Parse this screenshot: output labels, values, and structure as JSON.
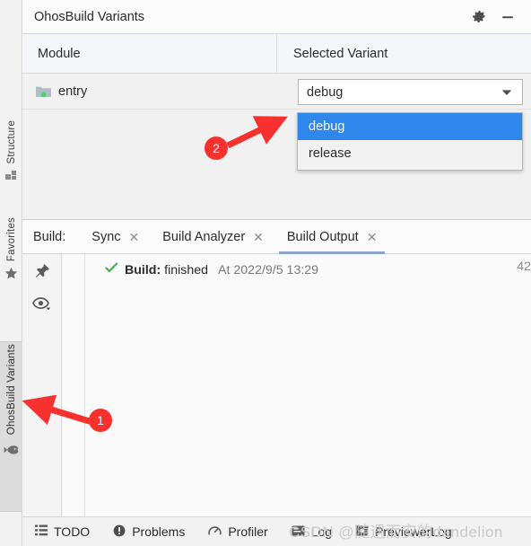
{
  "panel": {
    "title": "OhosBuild Variants",
    "actions": [
      {
        "name": "settings-icon",
        "label": "Settings"
      },
      {
        "name": "hide-icon",
        "label": "Hide"
      }
    ]
  },
  "table": {
    "columns": [
      "Module",
      "Selected Variant"
    ],
    "rows": [
      {
        "module": "entry",
        "module_icon": "folder-icon",
        "variant": "debug"
      }
    ]
  },
  "dropdown": {
    "open": true,
    "selected": "debug",
    "options": [
      "debug",
      "release"
    ],
    "highlight_color": "#2f86eb"
  },
  "sidebar": {
    "items": [
      {
        "label": "Structure",
        "icon": "structure-icon",
        "active": false
      },
      {
        "label": "Favorites",
        "icon": "star-icon",
        "active": false
      },
      {
        "label": "OhosBuild Variants",
        "icon": "fish-icon",
        "active": true
      }
    ]
  },
  "build_window": {
    "label": "Build:",
    "tabs": [
      {
        "label": "Sync",
        "closable": true,
        "active": false
      },
      {
        "label": "Build Analyzer",
        "closable": true,
        "active": false
      },
      {
        "label": "Build Output",
        "closable": true,
        "active": true
      }
    ],
    "close_glyph": "✕",
    "gutter_buttons": [
      {
        "name": "pin-icon",
        "label": "Pin Tab"
      },
      {
        "name": "eye-icon",
        "label": "Show Options"
      }
    ],
    "status": {
      "prefix": "Build:",
      "result": "finished",
      "timestamp": "At 2022/9/5 13:29",
      "duration": "42",
      "icon": "green-check-icon"
    }
  },
  "statusbar": {
    "items": [
      {
        "label": "TODO",
        "icon": "list-icon"
      },
      {
        "label": "Problems",
        "icon": "warning-icon"
      },
      {
        "label": "Profiler",
        "icon": "gauge-icon"
      },
      {
        "label": "Log",
        "icon": "log-icon"
      },
      {
        "label": "PreviewerLog",
        "icon": "previewer-icon"
      }
    ]
  },
  "annotations": [
    {
      "number": "1",
      "target": "OhosBuild Variants sidebar tab"
    },
    {
      "number": "2",
      "target": "debug dropdown option"
    }
  ],
  "watermark": "CSDN @随遇而安的dandelion"
}
